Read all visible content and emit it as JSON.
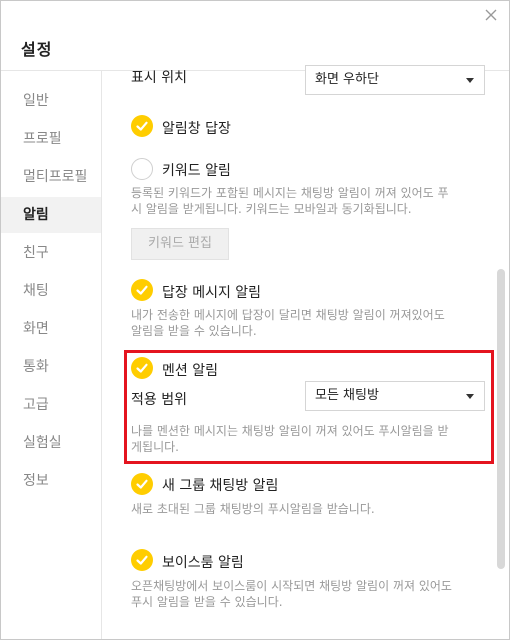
{
  "window": {
    "title": "설정",
    "close_icon": "close-icon"
  },
  "sidebar": {
    "items": [
      {
        "label": "일반"
      },
      {
        "label": "프로필"
      },
      {
        "label": "멀티프로필"
      },
      {
        "label": "알림",
        "active": true
      },
      {
        "label": "친구"
      },
      {
        "label": "채팅"
      },
      {
        "label": "화면"
      },
      {
        "label": "통화"
      },
      {
        "label": "고급"
      },
      {
        "label": "실험실"
      },
      {
        "label": "정보"
      }
    ]
  },
  "content": {
    "display_position": {
      "label": "표시 위치",
      "value": "화면 우하단"
    },
    "reply_in_notification": {
      "label": "알림창 답장",
      "checked": true
    },
    "keyword_alert": {
      "label": "키워드 알림",
      "checked": false,
      "desc": "등록된 키워드가 포함된 메시지는 채팅방 알림이 꺼져 있어도 푸시 알림을 받게됩니다. 키워드는 모바일과 동기화됩니다.",
      "desc_lines": [
        "등록된 키워드가 포함된 메시지는 채팅방 알림이 꺼져 있어도 푸",
        "시 알림을 받게됩니다. 키워드는 모바일과 동기화됩니다."
      ],
      "edit_button": "키워드 편집"
    },
    "reply_alert": {
      "label": "답장 메시지 알림",
      "checked": true,
      "desc_lines": [
        "내가 전송한 메시지에 답장이 달리면 채팅방 알림이 꺼져있어도",
        "알림을 받을 수 있습니다."
      ]
    },
    "mention_alert": {
      "label": "멘션 알림",
      "checked": true,
      "scope_label": "적용 범위",
      "scope_value": "모든 채팅방",
      "desc_lines": [
        "나를 멘션한 메시지는 채팅방 알림이 꺼져 있어도 푸시알림을 받",
        "게됩니다."
      ]
    },
    "new_group_alert": {
      "label": "새 그룹 채팅방 알림",
      "checked": true,
      "desc_lines": [
        "새로 초대된 그룹 채팅방의 푸시알림을 받습니다."
      ]
    },
    "voiceroom_alert": {
      "label": "보이스룸 알림",
      "checked": true,
      "desc_lines": [
        "오픈채팅방에서 보이스룸이 시작되면 채팅방 알림이 꺼져 있어도",
        "푸시 알림을 받을 수 있습니다."
      ]
    }
  },
  "colors": {
    "accent": "#ffcd00",
    "highlight_border": "#e4141f"
  }
}
